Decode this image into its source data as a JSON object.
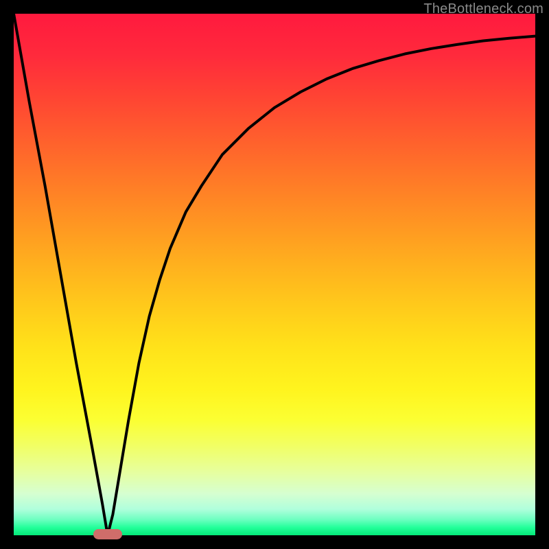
{
  "watermark": "TheBottleneck.com",
  "colors": {
    "frame": "#000000",
    "curve": "#000000",
    "marker": "#cf6d6a"
  },
  "chart_data": {
    "type": "line",
    "title": "",
    "xlabel": "",
    "ylabel": "",
    "xlim": [
      0,
      100
    ],
    "ylim": [
      0,
      100
    ],
    "grid": false,
    "legend": false,
    "series": [
      {
        "name": "bottleneck-curve",
        "x": [
          0,
          3,
          6,
          9,
          12,
          15,
          17,
          18,
          19,
          20,
          22,
          24,
          26,
          28,
          30,
          33,
          36,
          40,
          45,
          50,
          55,
          60,
          65,
          70,
          75,
          80,
          85,
          90,
          95,
          100
        ],
        "y": [
          100,
          83,
          67,
          50,
          33,
          17,
          6,
          0,
          4,
          10,
          22,
          33,
          42,
          49,
          55,
          62,
          67,
          73,
          78,
          82,
          85,
          87.5,
          89.5,
          91,
          92.3,
          93.3,
          94.1,
          94.8,
          95.3,
          95.7
        ]
      }
    ],
    "annotations": [
      {
        "name": "minimum-marker",
        "x": 18,
        "y": 0
      }
    ]
  }
}
